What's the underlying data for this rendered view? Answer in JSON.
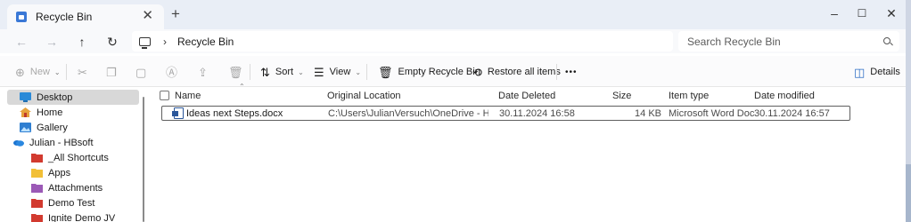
{
  "tab": {
    "title": "Recycle Bin",
    "close": "✕",
    "new": "+"
  },
  "window_controls": {
    "minimize": "–",
    "maximize": "☐",
    "close": "✕"
  },
  "nav": {
    "back": "←",
    "forward": "→",
    "up": "↑",
    "refresh": "↻"
  },
  "address": {
    "separator": "›",
    "crumb": "Recycle Bin"
  },
  "search": {
    "placeholder": "Search Recycle Bin"
  },
  "commands": {
    "new": "New",
    "sort": "Sort",
    "view": "View",
    "empty": "Empty Recycle Bin",
    "restore": "Restore all items",
    "more": "•••",
    "details": "Details"
  },
  "sidebar": {
    "items": [
      {
        "label": "Desktop",
        "icon": "desktop-icon"
      },
      {
        "label": "Home",
        "icon": "home-icon"
      },
      {
        "label": "Gallery",
        "icon": "gallery-icon"
      },
      {
        "label": "Julian - HBsoft",
        "icon": "onedrive-icon"
      },
      {
        "label": "_All Shortcuts",
        "icon": "folder-red-icon"
      },
      {
        "label": "Apps",
        "icon": "folder-yellow-icon"
      },
      {
        "label": "Attachments",
        "icon": "folder-purple-icon"
      },
      {
        "label": "Demo Test",
        "icon": "folder-red-icon"
      },
      {
        "label": "Ignite Demo JV",
        "icon": "folder-red-icon"
      }
    ]
  },
  "columns": {
    "name": "Name",
    "original_location": "Original Location",
    "date_deleted": "Date Deleted",
    "size": "Size",
    "item_type": "Item type",
    "date_modified": "Date modified"
  },
  "files": [
    {
      "name": "Ideas next Steps.docx",
      "original_location": "C:\\Users\\JulianVersuch\\OneDrive - HBsoft\\Ne...",
      "date_deleted": "30.11.2024 16:58",
      "size": "14 KB",
      "item_type": "Microsoft Word Doc...",
      "date_modified": "30.11.2024 16:57"
    }
  ],
  "colors": {
    "accent": "#3a78d6",
    "selected": "#d8d8d8",
    "word": "#2b579a"
  }
}
